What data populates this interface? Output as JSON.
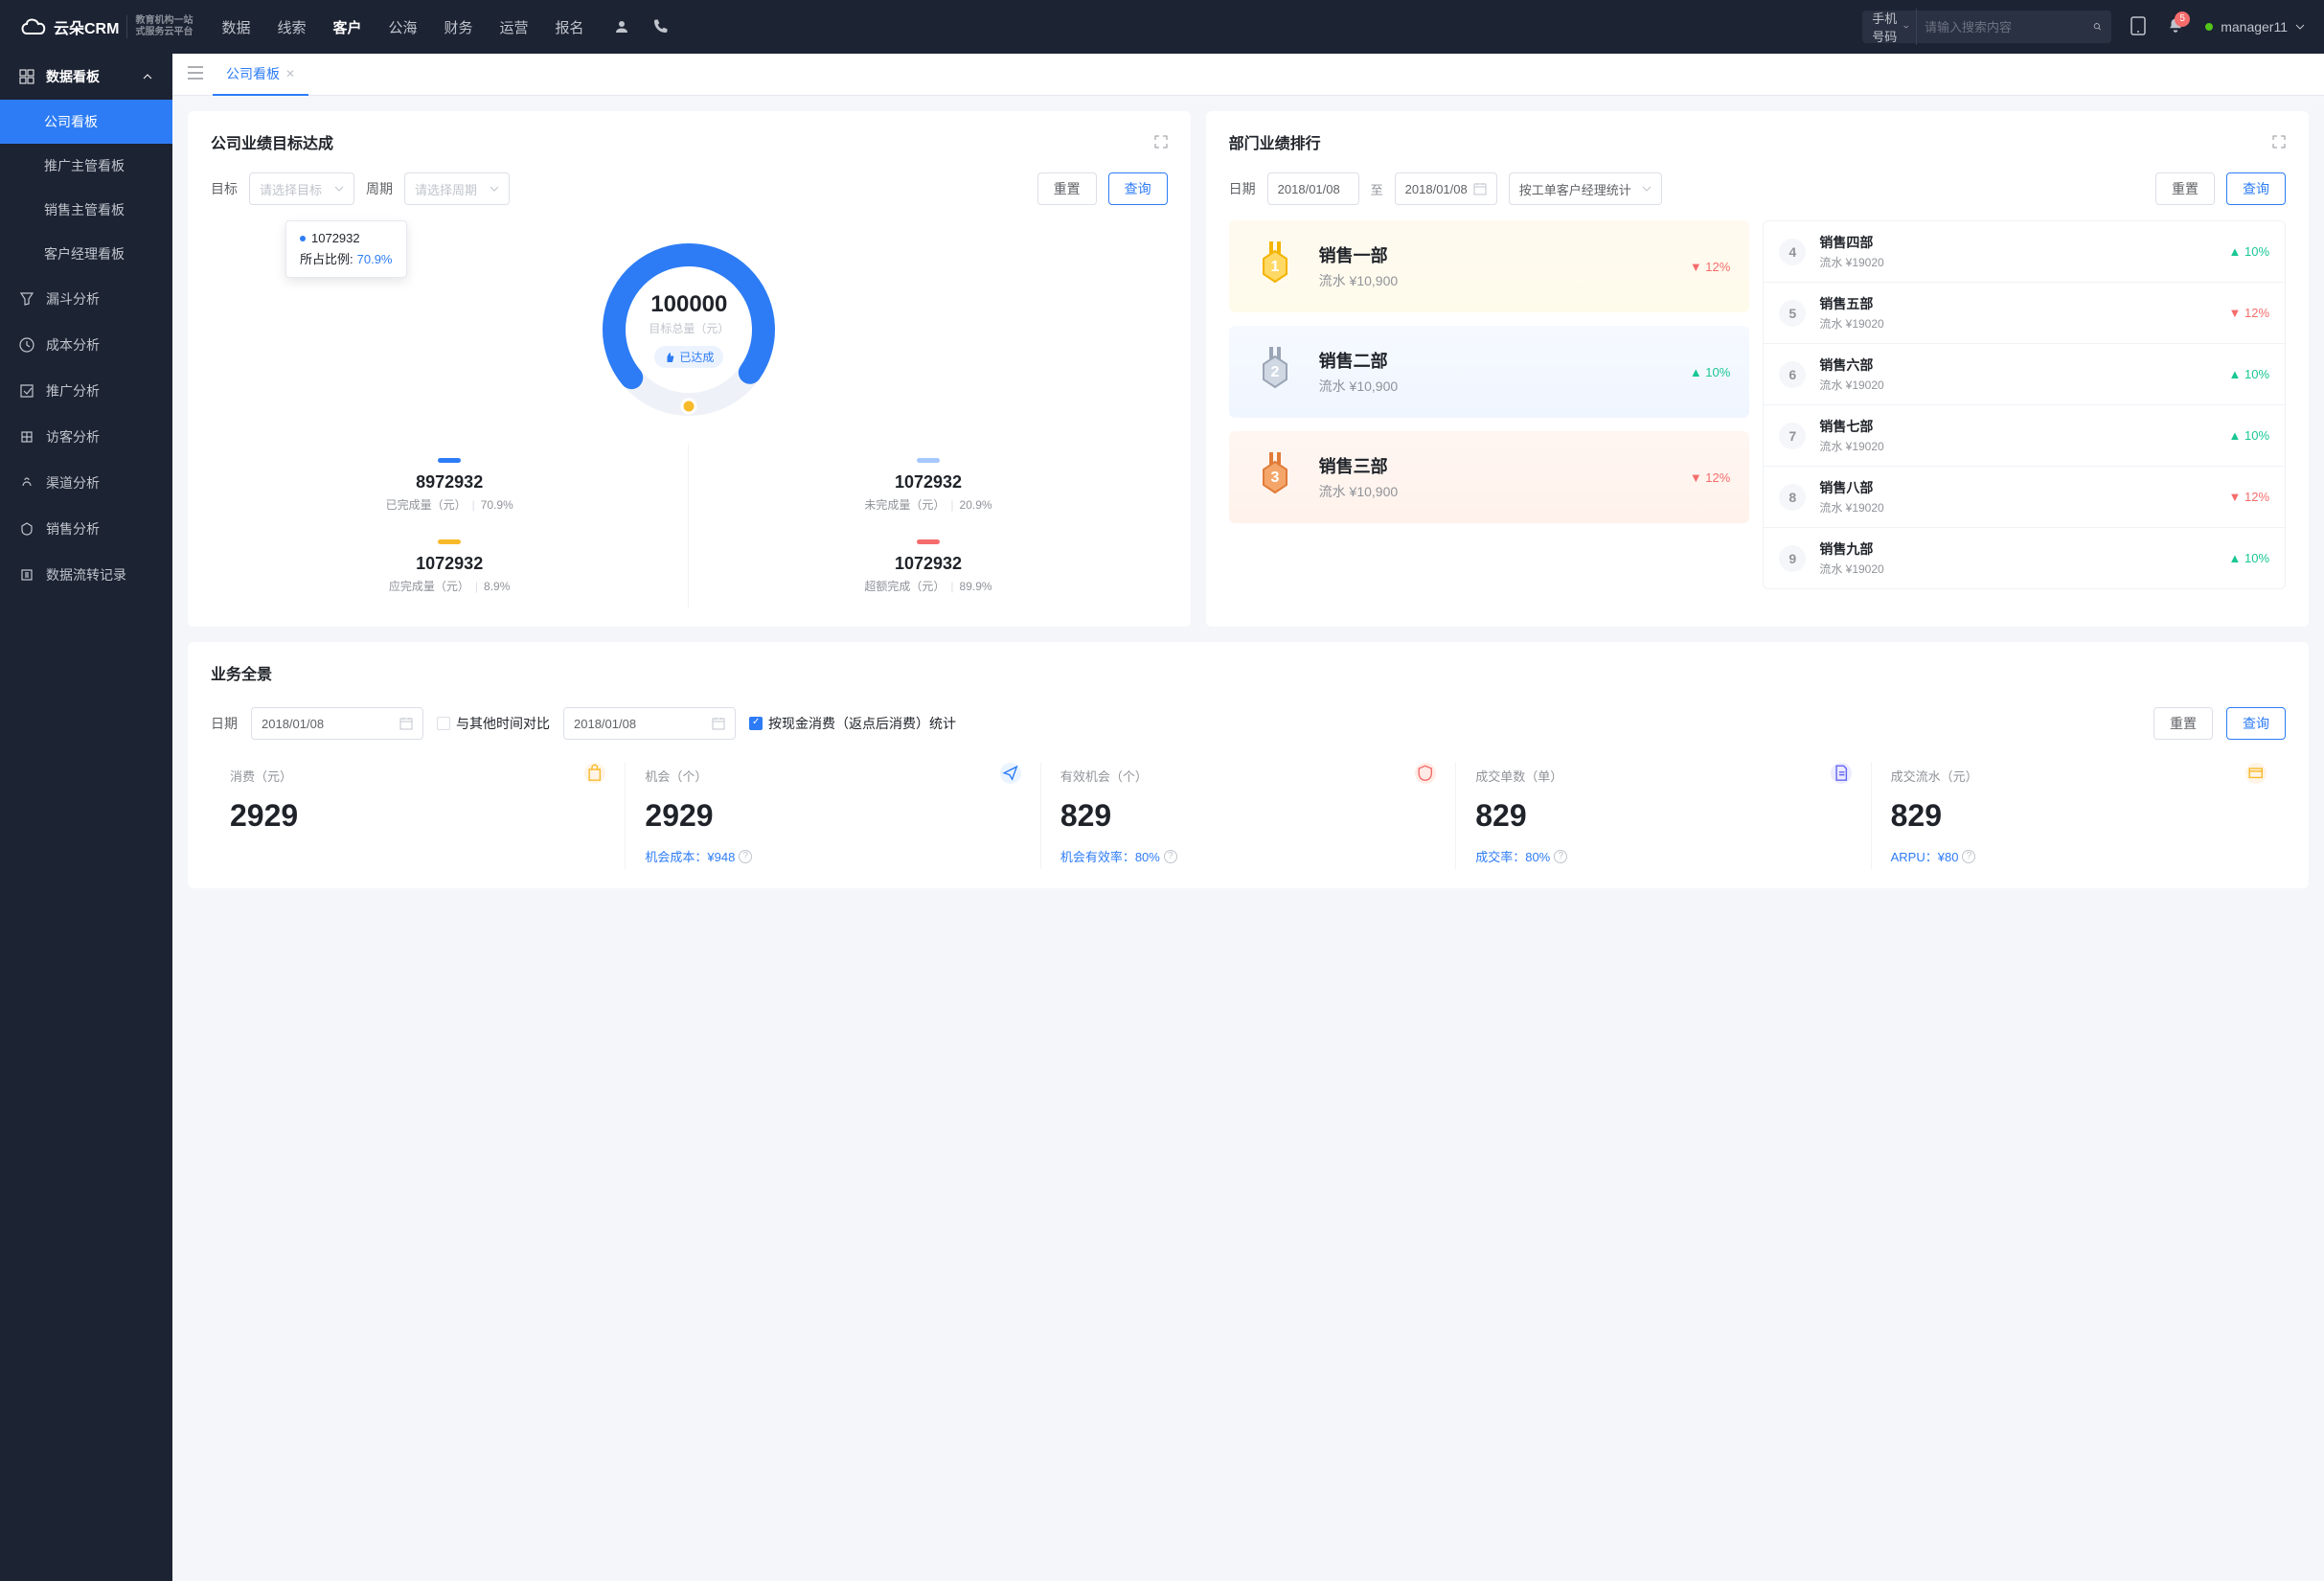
{
  "header": {
    "logo_text": "云朵CRM",
    "logo_sub1": "教育机构一站",
    "logo_sub2": "式服务云平台",
    "nav": [
      "数据",
      "线索",
      "客户",
      "公海",
      "财务",
      "运营",
      "报名"
    ],
    "nav_active": 2,
    "search_type": "手机号码",
    "search_placeholder": "请输入搜索内容",
    "badge_count": "5",
    "user": "manager11"
  },
  "sidebar": {
    "head": "数据看板",
    "subs": [
      "公司看板",
      "推广主管看板",
      "销售主管看板",
      "客户经理看板"
    ],
    "items": [
      "漏斗分析",
      "成本分析",
      "推广分析",
      "访客分析",
      "渠道分析",
      "销售分析",
      "数据流转记录"
    ]
  },
  "tab": {
    "label": "公司看板"
  },
  "target": {
    "title": "公司业绩目标达成",
    "label_goal": "目标",
    "goal_placeholder": "请选择目标",
    "label_period": "周期",
    "period_placeholder": "请选择周期",
    "btn_reset": "重置",
    "btn_query": "查询",
    "donut_value": "100000",
    "donut_label": "目标总量（元）",
    "donut_tag": "已达成",
    "tooltip_value": "1072932",
    "tooltip_label": "所占比例:",
    "tooltip_pct": "70.9%",
    "stats": [
      {
        "bar_color": "#2d7cf5",
        "value": "8972932",
        "label": "已完成量（元）",
        "pct": "70.9%"
      },
      {
        "bar_color": "#a6c8ff",
        "value": "1072932",
        "label": "未完成量（元）",
        "pct": "20.9%"
      },
      {
        "bar_color": "#f7ba2a",
        "value": "1072932",
        "label": "应完成量（元）",
        "pct": "8.9%"
      },
      {
        "bar_color": "#f56c6c",
        "value": "1072932",
        "label": "超额完成（元）",
        "pct": "89.9%"
      }
    ]
  },
  "rank": {
    "title": "部门业绩排行",
    "label_date": "日期",
    "date_from": "2018/01/08",
    "date_sep": "至",
    "date_to": "2018/01/08",
    "stats_by": "按工单客户经理统计",
    "btn_reset": "重置",
    "btn_query": "查询",
    "top3": [
      {
        "name": "销售一部",
        "amount": "流水 ¥10,900",
        "trend": "down",
        "pct": "12%"
      },
      {
        "name": "销售二部",
        "amount": "流水 ¥10,900",
        "trend": "up",
        "pct": "10%"
      },
      {
        "name": "销售三部",
        "amount": "流水 ¥10,900",
        "trend": "down",
        "pct": "12%"
      }
    ],
    "rest": [
      {
        "num": "4",
        "name": "销售四部",
        "amount": "流水 ¥19020",
        "trend": "up",
        "pct": "10%"
      },
      {
        "num": "5",
        "name": "销售五部",
        "amount": "流水 ¥19020",
        "trend": "down",
        "pct": "12%"
      },
      {
        "num": "6",
        "name": "销售六部",
        "amount": "流水 ¥19020",
        "trend": "up",
        "pct": "10%"
      },
      {
        "num": "7",
        "name": "销售七部",
        "amount": "流水 ¥19020",
        "trend": "up",
        "pct": "10%"
      },
      {
        "num": "8",
        "name": "销售八部",
        "amount": "流水 ¥19020",
        "trend": "down",
        "pct": "12%"
      },
      {
        "num": "9",
        "name": "销售九部",
        "amount": "流水 ¥19020",
        "trend": "up",
        "pct": "10%"
      }
    ]
  },
  "overview": {
    "title": "业务全景",
    "label_date": "日期",
    "date1": "2018/01/08",
    "compare_label": "与其他时间对比",
    "date2": "2018/01/08",
    "cash_label": "按现金消费（返点后消费）统计",
    "btn_reset": "重置",
    "btn_query": "查询",
    "stats": [
      {
        "title": "消费（元）",
        "value": "2929",
        "sub": "",
        "icon_bg": "#fff4e6",
        "icon_fg": "#f7ba2a",
        "icon": "bag"
      },
      {
        "title": "机会（个）",
        "value": "2929",
        "sub_label": "机会成本：",
        "sub_val": "¥948",
        "icon_bg": "#eaf4ff",
        "icon_fg": "#2d7cf5",
        "icon": "send"
      },
      {
        "title": "有效机会（个）",
        "value": "829",
        "sub_label": "机会有效率：",
        "sub_val": "80%",
        "icon_bg": "#ffece6",
        "icon_fg": "#f56c6c",
        "icon": "shield"
      },
      {
        "title": "成交单数（单）",
        "value": "829",
        "sub_label": "成交率：",
        "sub_val": "80%",
        "icon_bg": "#ecebff",
        "icon_fg": "#6366f1",
        "icon": "doc"
      },
      {
        "title": "成交流水（元）",
        "value": "829",
        "sub_label": "ARPU：",
        "sub_val": "¥80",
        "icon_bg": "#fff4e6",
        "icon_fg": "#f7ba2a",
        "icon": "card"
      }
    ]
  },
  "chart_data": {
    "type": "pie",
    "title": "公司业绩目标达成",
    "total": 100000,
    "total_label": "目标总量（元）",
    "series": [
      {
        "name": "已完成量（元）",
        "value": 8972932,
        "pct": 70.9,
        "color": "#2d7cf5"
      },
      {
        "name": "未完成量（元）",
        "value": 1072932,
        "pct": 20.9,
        "color": "#a6c8ff"
      },
      {
        "name": "应完成量（元）",
        "value": 1072932,
        "pct": 8.9,
        "color": "#f7ba2a"
      },
      {
        "name": "超额完成（元）",
        "value": 1072932,
        "pct": 89.9,
        "color": "#f56c6c"
      }
    ]
  }
}
